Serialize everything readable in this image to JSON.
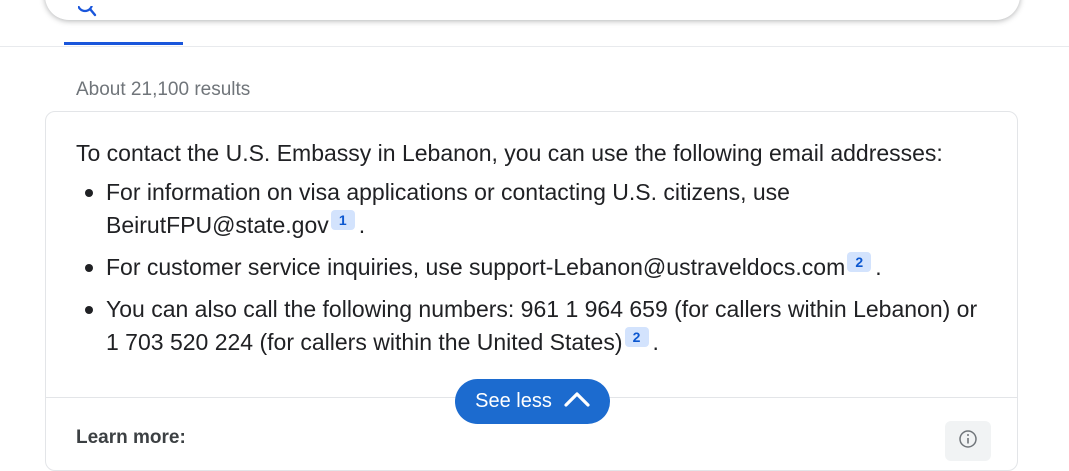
{
  "search": {
    "icon": "search-icon",
    "accent_color": "#1a56db"
  },
  "results": {
    "stats": "About 21,100 results"
  },
  "answer": {
    "intro": "To contact the U.S. Embassy in Lebanon, you can use the following email addresses:",
    "bullets": [
      {
        "text": "For information on visa applications or contacting U.S. citizens, use BeirutFPU@state.gov",
        "cite": "1",
        "end": "."
      },
      {
        "text": "For customer service inquiries, use support-Lebanon@ustraveldocs.com",
        "cite": "2",
        "end": "."
      },
      {
        "text": "You can also call the following numbers: 961 1 964 659 (for callers within Lebanon) or 1 703 520 224 (for callers within the United States)",
        "cite": "2",
        "end": "."
      }
    ],
    "see_less_label": "See less",
    "see_less_icon": "chevron-up-icon",
    "learn_more_label": "Learn more:",
    "info_icon": "info-icon",
    "citation_color": "#d3e3fd",
    "button_color": "#1c6bcf"
  }
}
